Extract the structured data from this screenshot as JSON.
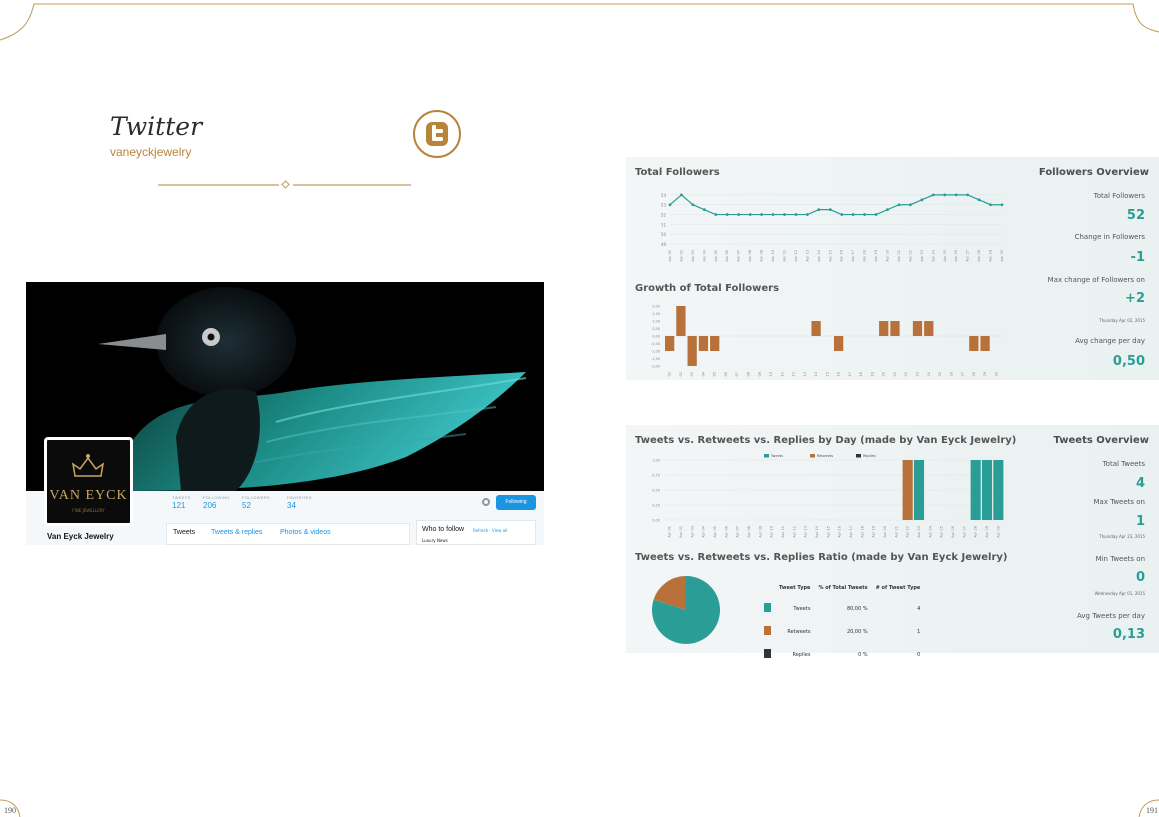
{
  "header": {
    "title": "Twitter",
    "handle": "vaneyckjewelry"
  },
  "profile": {
    "avatar_brand": "VAN EYCK",
    "avatar_sub": "FINE JEWELLERY",
    "name": "Van Eyck Jewelry",
    "stats": [
      {
        "label": "TWEETS",
        "value": "121"
      },
      {
        "label": "FOLLOWING",
        "value": "206"
      },
      {
        "label": "FOLLOWERS",
        "value": "52"
      },
      {
        "label": "FAVORITES",
        "value": "34"
      }
    ],
    "follow_button": "Following",
    "tabs": [
      "Tweets",
      "Tweets & replies",
      "Photos & videos"
    ],
    "who_to_follow": {
      "title": "Who to follow",
      "links": "Refresh · View all",
      "item": "Luxury News"
    }
  },
  "followers_panel": {
    "chart_title": "Total Followers",
    "growth_title": "Growth of Total Followers",
    "overview_title": "Followers Overview",
    "stats": [
      {
        "label": "Total Followers",
        "value": "52"
      },
      {
        "label": "Change in Followers",
        "value": "-1"
      },
      {
        "label": "Max change of Followers on",
        "value": "+2",
        "date": "Thursday Apr 02, 2015"
      },
      {
        "label": "Avg change per day",
        "value": "0,50"
      }
    ]
  },
  "tweets_panel": {
    "chart_title": "Tweets vs. Retweets vs. Replies by Day (made by Van Eyck Jewelry)",
    "ratio_title": "Tweets vs. Retweets vs. Replies Ratio (made by Van Eyck Jewelry)",
    "overview_title": "Tweets Overview",
    "stats": [
      {
        "label": "Total Tweets",
        "value": "4"
      },
      {
        "label": "Max Tweets on",
        "value": "1",
        "date": "Thursday Apr 23, 2015"
      },
      {
        "label": "Min Tweets on",
        "value": "0",
        "date": "Wednesday Apr 01, 2015"
      },
      {
        "label": "Avg Tweets per day",
        "value": "0,13"
      }
    ],
    "table": {
      "headers": [
        "Tweet Type",
        "% of Total Tweets",
        "# of Tweet Type"
      ],
      "rows": [
        {
          "type": "Tweets",
          "pct": "80,00 %",
          "count": "4",
          "color": "#2a9d97"
        },
        {
          "type": "Retweets",
          "pct": "20,00 %",
          "count": "1",
          "color": "#b8713a"
        },
        {
          "type": "Replies",
          "pct": "0 %",
          "count": "0",
          "color": "#333333"
        }
      ]
    }
  },
  "chart_data": [
    {
      "type": "line",
      "title": "Total Followers",
      "x": [
        "Apr 01",
        "Apr 02",
        "Apr 03",
        "Apr 04",
        "Apr 05",
        "Apr 06",
        "Apr 07",
        "Apr 08",
        "Apr 09",
        "Apr 10",
        "Apr 11",
        "Apr 12",
        "Apr 13",
        "Apr 14",
        "Apr 15",
        "Apr 16",
        "Apr 17",
        "Apr 18",
        "Apr 19",
        "Apr 20",
        "Apr 21",
        "Apr 22",
        "Apr 23",
        "Apr 24",
        "Apr 25",
        "Apr 26",
        "Apr 27",
        "Apr 28",
        "Apr 29",
        "Apr 30"
      ],
      "values": [
        53,
        54,
        53,
        52.5,
        52,
        52,
        52,
        52,
        52,
        52,
        52,
        52,
        52,
        52.5,
        52.5,
        52,
        52,
        52,
        52,
        52.5,
        53,
        53,
        53.5,
        54,
        54,
        54,
        54,
        53.5,
        53,
        53
      ],
      "yticks": [
        "54",
        "53",
        "52",
        "51",
        "50",
        "49"
      ],
      "ylim": [
        49,
        54.5
      ],
      "color": "#2a9d97"
    },
    {
      "type": "bar",
      "title": "Growth of Total Followers",
      "x": [
        "Apr 01",
        "Apr 02",
        "Apr 03",
        "Apr 04",
        "Apr 05",
        "Apr 06",
        "Apr 07",
        "Apr 08",
        "Apr 09",
        "Apr 10",
        "Apr 11",
        "Apr 12",
        "Apr 13",
        "Apr 14",
        "Apr 15",
        "Apr 16",
        "Apr 17",
        "Apr 18",
        "Apr 19",
        "Apr 20",
        "Apr 21",
        "Apr 22",
        "Apr 23",
        "Apr 24",
        "Apr 25",
        "Apr 26",
        "Apr 27",
        "Apr 28",
        "Apr 29",
        "Apr 30"
      ],
      "values": [
        -1,
        2,
        -2,
        -1,
        -1,
        0,
        0,
        0,
        0,
        0,
        0,
        0,
        0,
        1,
        0,
        -1,
        0,
        0,
        0,
        1,
        1,
        0,
        1,
        1,
        0,
        0,
        0,
        -1,
        -1,
        0
      ],
      "yticks": [
        "2,00",
        "1,50",
        "1,00",
        "0,50",
        "0,00",
        "-0,50",
        "-1,00",
        "-1,50",
        "-2,00"
      ],
      "ylim": [
        -2,
        2
      ],
      "color": "#b8713a"
    },
    {
      "type": "bar",
      "title": "Tweets vs. Retweets vs. Replies by Day (made by Van Eyck Jewelry)",
      "x": [
        "Apr 01",
        "Apr 02",
        "Apr 03",
        "Apr 04",
        "Apr 05",
        "Apr 06",
        "Apr 07",
        "Apr 08",
        "Apr 09",
        "Apr 10",
        "Apr 11",
        "Apr 12",
        "Apr 13",
        "Apr 14",
        "Apr 15",
        "Apr 16",
        "Apr 17",
        "Apr 18",
        "Apr 19",
        "Apr 20",
        "Apr 21",
        "Apr 22",
        "Apr 23",
        "Apr 24",
        "Apr 25",
        "Apr 26",
        "Apr 27",
        "Apr 28",
        "Apr 29",
        "Apr 30"
      ],
      "yticks": [
        "1,00",
        "0,75",
        "0,50",
        "0,25",
        "0,00"
      ],
      "ylim": [
        0,
        1
      ],
      "legend": "top",
      "series": [
        {
          "name": "Tweets",
          "color": "#2a9d97",
          "values": [
            0,
            0,
            0,
            0,
            0,
            0,
            0,
            0,
            0,
            0,
            0,
            0,
            0,
            0,
            0,
            0,
            0,
            0,
            0,
            0,
            0,
            0,
            1,
            0,
            0,
            0,
            0,
            1,
            1,
            1
          ]
        },
        {
          "name": "Retweets",
          "color": "#b8713a",
          "values": [
            0,
            0,
            0,
            0,
            0,
            0,
            0,
            0,
            0,
            0,
            0,
            0,
            0,
            0,
            0,
            0,
            0,
            0,
            0,
            0,
            0,
            1,
            0,
            0,
            0,
            0,
            0,
            0,
            0,
            0
          ]
        },
        {
          "name": "Replies",
          "color": "#333333",
          "values": [
            0,
            0,
            0,
            0,
            0,
            0,
            0,
            0,
            0,
            0,
            0,
            0,
            0,
            0,
            0,
            0,
            0,
            0,
            0,
            0,
            0,
            0,
            0,
            0,
            0,
            0,
            0,
            0,
            0,
            0
          ]
        }
      ]
    },
    {
      "type": "pie",
      "title": "Tweets vs. Retweets vs. Replies Ratio (made by Van Eyck Jewelry)",
      "categories": [
        "Tweets",
        "Retweets",
        "Replies"
      ],
      "values": [
        80,
        20,
        0
      ],
      "colors": [
        "#2a9d97",
        "#b8713a",
        "#333333"
      ]
    }
  ],
  "page_numbers": {
    "left": "190",
    "right": "191"
  }
}
